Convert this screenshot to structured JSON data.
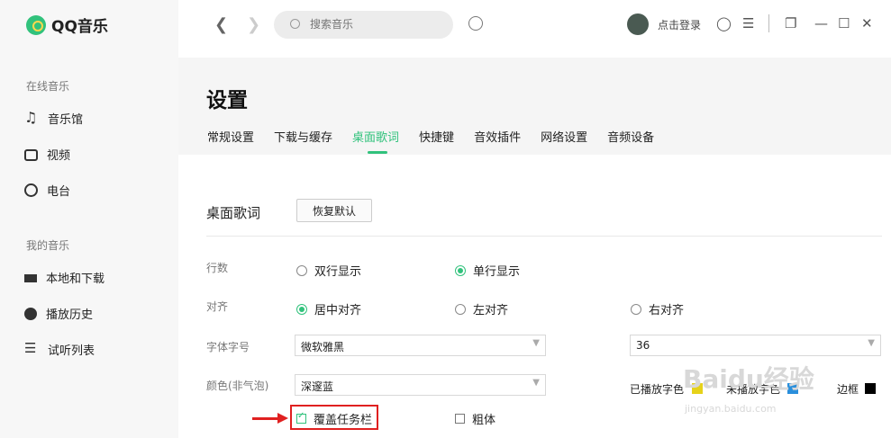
{
  "app": {
    "name": "QQ音乐"
  },
  "sidebar": {
    "online_title": "在线音乐",
    "online_items": [
      {
        "label": "音乐馆",
        "icon": "music-note-icon"
      },
      {
        "label": "视频",
        "icon": "video-icon"
      },
      {
        "label": "电台",
        "icon": "radio-icon"
      }
    ],
    "mine_title": "我的音乐",
    "mine_items": [
      {
        "label": "本地和下载",
        "icon": "monitor-icon"
      },
      {
        "label": "播放历史",
        "icon": "history-icon"
      },
      {
        "label": "试听列表",
        "icon": "playlist-icon"
      }
    ]
  },
  "topbar": {
    "search_placeholder": "搜索音乐",
    "login_label": "点击登录",
    "icons": [
      "back-icon",
      "forward-icon",
      "search-icon",
      "mic-icon",
      "avatar",
      "skin-icon",
      "menu-icon",
      "mini-mode-icon",
      "minimize-icon",
      "maximize-icon",
      "close-icon"
    ]
  },
  "page": {
    "title": "设置",
    "tabs": [
      "常规设置",
      "下载与缓存",
      "桌面歌词",
      "快捷键",
      "音效插件",
      "网络设置",
      "音频设备"
    ],
    "active_tab": "桌面歌词"
  },
  "lyrics": {
    "section_title": "桌面歌词",
    "reset_label": "恢复默认",
    "rows_label": "行数",
    "rows_options": [
      "双行显示",
      "单行显示"
    ],
    "rows_selected": "单行显示",
    "align_label": "对齐",
    "align_options": [
      "居中对齐",
      "左对齐",
      "右对齐"
    ],
    "align_selected": "居中对齐",
    "font_label": "字体字号",
    "font_value": "微软雅黑",
    "size_value": "36",
    "color_label": "颜色(非气泡)",
    "color_value": "深邃蓝",
    "played_color_label": "已播放字色",
    "unplayed_color_label": "未播放字色",
    "border_label": "边框",
    "played_color": "#e6d21a",
    "unplayed_color": "#2a8fdc",
    "border_color": "#000000",
    "cover_taskbar_label": "覆盖任务栏",
    "cover_taskbar_checked": true,
    "bold_label": "粗体",
    "bold_checked": false
  },
  "colors": {
    "accent": "#31c27c",
    "annotation": "#e02020"
  },
  "watermark": {
    "text": "Baidu经验",
    "url_text": "jingyan.baidu.com"
  }
}
